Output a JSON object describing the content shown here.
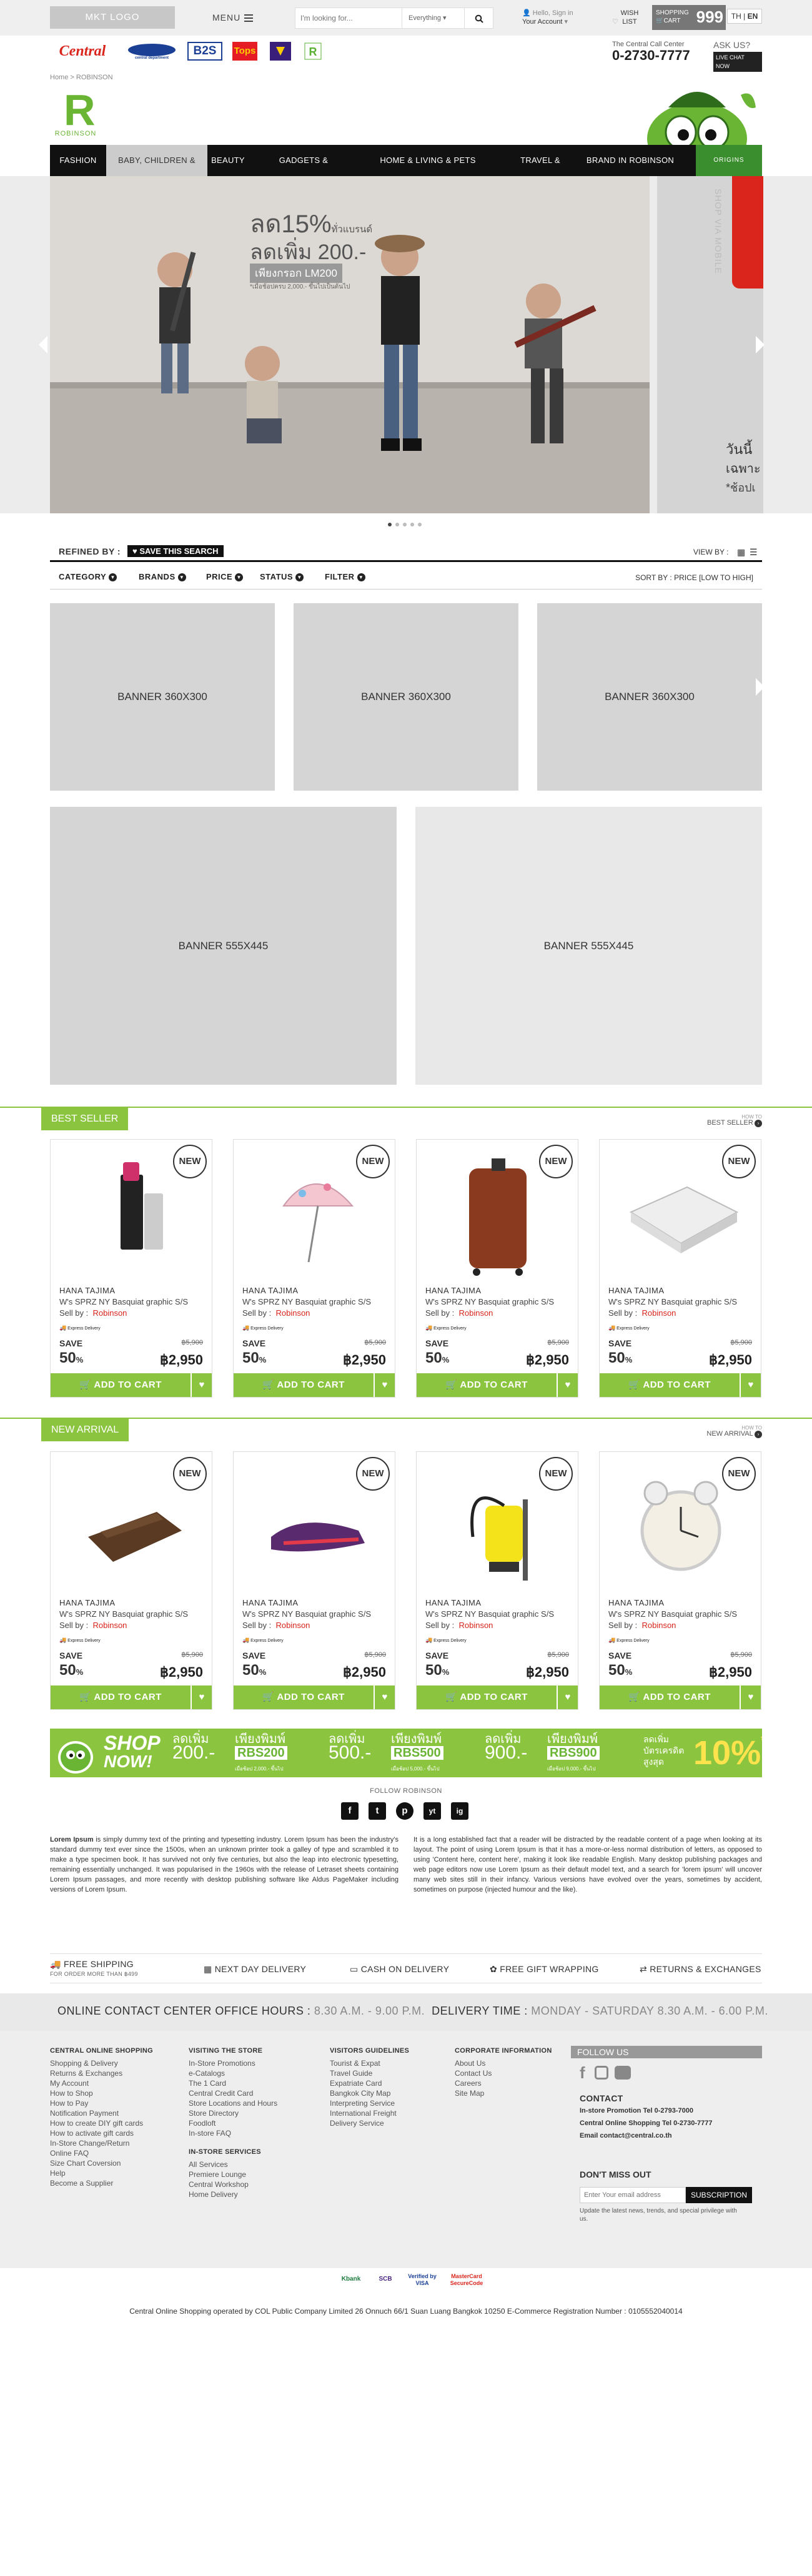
{
  "topbar": {
    "logo": "MKT LOGO",
    "menu": "MENU",
    "search_placeholder": "I'm looking for...",
    "search_category": "Everything",
    "account_greeting": "Hello, Sign in",
    "account_label": "Your Account",
    "wish_label": "WISH LIST",
    "cart_label_1": "SHOPPING",
    "cart_label_2": "CART",
    "cart_count": "999",
    "lang_th": "TH",
    "lang_en": "EN"
  },
  "brands": [
    "Central",
    "Central Department",
    "B2S",
    "Tops",
    "Supersports",
    "Robinson"
  ],
  "contact": {
    "label": "The Central Call Center",
    "number": "0-2730-7777",
    "ask": "ASK US?",
    "chat": "LIVE CHAT NOW"
  },
  "breadcrumb": "Home > ROBINSON",
  "logo_text": "ROBINSON",
  "nav": [
    "FASHION",
    "BABY, CHILDREN & TOYS",
    "BEAUTY",
    "GADGETS & ELECTRONICS",
    "HOME & LIVING & PETS SUPPLIES",
    "TRAVEL & LIFESTYLE",
    "BRAND IN ROBINSON"
  ],
  "nav_logo": "ORIGINS",
  "hero": {
    "line1": "ลด15%",
    "line1b": "ทั่วแบรนด์",
    "line2": "ลดเพิ่ม 200.-",
    "line3": "เพียงกรอก LM200",
    "line4": "*เมื่อช้อปครบ 2,000.- ขึ้นไปเป็นต้นไป",
    "side_text": "SHOP VIA MOBILE",
    "side_thai": "วันนี้",
    "side_thai2": "เฉพาะ",
    "side_thai3": "*ช้อปเ",
    "slides": 5,
    "active": 1
  },
  "refine": {
    "label": "REFINED BY :",
    "save": "SAVE THIS SEARCH",
    "view_by": "VIEW BY :"
  },
  "filters": [
    "CATEGORY",
    "BRANDS",
    "PRICE",
    "STATUS",
    "FILTER"
  ],
  "sort": "SORT BY : PRICE [LOW TO HIGH]",
  "banners_small": [
    "BANNER 360X300",
    "BANNER 360X300",
    "BANNER 360X300"
  ],
  "banners_large": [
    "BANNER 555X445",
    "BANNER 555X445"
  ],
  "sections": [
    {
      "title": "BEST SELLER",
      "howto": "HOW TO",
      "link": "BEST SELLER"
    },
    {
      "title": "NEW ARRIVAL",
      "howto": "HOW TO",
      "link": "NEW ARRIVAL"
    }
  ],
  "product": {
    "badge": "NEW",
    "brand": "HANA TAJIMA",
    "name": "W's SPRZ NY Basquiat graphic S/S",
    "sell_by": "Sell by :",
    "seller": "Robinson",
    "express": "Express Delivery",
    "save": "SAVE",
    "old_price": "฿5,900",
    "percent": "50",
    "percent_sign": "%",
    "price": "฿2,950",
    "add_to_cart": "ADD TO CART"
  },
  "promo": {
    "shop": "SHOP",
    "now": "NOW!",
    "items": [
      {
        "a": "ลดเพิ่ม",
        "b": "200.-",
        "c": "เพียงพิมพ์",
        "d": "RBS200",
        "e": "เมื่อช้อป 2,000.- ขึ้นไป"
      },
      {
        "a": "ลดเพิ่ม",
        "b": "500.-",
        "c": "เพียงพิมพ์",
        "d": "RBS500",
        "e": "เมื่อช้อป 5,000.- ขึ้นไป"
      },
      {
        "a": "ลดเพิ่ม",
        "b": "900.-",
        "c": "เพียงพิมพ์",
        "d": "RBS900",
        "e": "เมื่อช้อป 9,000.- ขึ้นไป"
      }
    ],
    "card_a": "ลดเพิ่ม",
    "card_b": "บัตรเครดิต",
    "card_c": "สูงสุด",
    "card_pct": "10%",
    "card_star": "*"
  },
  "follow": "FOLLOW ROBINSON",
  "social": [
    "f",
    "t",
    "p",
    "yt",
    "ig"
  ],
  "lorem_left_bold": "Lorem Ipsum",
  "lorem_left": " is simply dummy text of the printing and typesetting industry. Lorem Ipsum has been the industry's standard dummy text ever since the 1500s, when an unknown printer took a galley of type and scrambled it to make a type specimen book. It has survived not only five centuries, but also the leap into electronic typesetting, remaining essentially unchanged. It was popularised in the 1960s with the release of Letraset sheets containing Lorem Ipsum passages, and more recently with desktop publishing software like Aldus PageMaker including versions of Lorem Ipsum.",
  "lorem_right": "It is a long established fact that a reader will be distracted by the readable content of a page when looking at its layout. The point of using Lorem Ipsum is that it has a more-or-less normal distribution of letters, as opposed to using 'Content here, content here', making it look like readable English. Many desktop publishing packages and web page editors now use Lorem Ipsum as their default model text, and a search for 'lorem ipsum' will uncover many web sites still in their infancy. Various versions have evolved over the years, sometimes by accident, sometimes on purpose (injected humour and the like).",
  "services": [
    {
      "label": "FREE SHIPPING",
      "sub": "FOR ORDER MORE THAN ฿499"
    },
    {
      "label": "NEXT DAY DELIVERY",
      "sub": ""
    },
    {
      "label": "CASH ON DELIVERY",
      "sub": ""
    },
    {
      "label": "FREE GIFT WRAPPING",
      "sub": ""
    },
    {
      "label": "RETURNS & EXCHANGES",
      "sub": ""
    }
  ],
  "office": {
    "label": "ONLINE CONTACT CENTER OFFICE HOURS :",
    "hours": "8.30 A.M. - 9.00 P.M.",
    "delivery_label": "DELIVERY TIME :",
    "delivery": "MONDAY - SATURDAY 8.30 A.M. - 6.00 P.M."
  },
  "footer": {
    "col1_title": "CENTRAL ONLINE SHOPPING",
    "col1": [
      "Shopping & Delivery",
      "Returns & Exchanges",
      "My Account",
      "How to Shop",
      "How to Pay",
      "Notification Payment",
      "How to create DIY gift cards",
      "How to activate gift cards",
      "In-Store Change/Return",
      "Online FAQ",
      "Size Chart Coversion",
      "Help",
      "Become a Supplier"
    ],
    "col2_title": "VISITING THE STORE",
    "col2": [
      "In-Store Promotions",
      "e-Catalogs",
      "The 1 Card",
      "Central Credit Card",
      "Store Locations and Hours",
      "Store Directory",
      "Foodloft",
      "In-store FAQ"
    ],
    "col2b_title": "IN-STORE SERVICES",
    "col2b": [
      "All Services",
      "Premiere Lounge",
      "Central Workshop",
      "Home Delivery"
    ],
    "col3_title": "VISITORS GUIDELINES",
    "col3": [
      "Tourist & Expat",
      "Travel Guide",
      "Expatriate Card",
      "Bangkok City Map",
      "Interpreting Service",
      "International Freight",
      "Delivery Service"
    ],
    "col4_title": "CORPORATE INFORMATION",
    "col4": [
      "About Us",
      "Contact Us",
      "Careers",
      "Site Map"
    ],
    "follow_us": "FOLLOW US",
    "contact_title": "CONTACT",
    "contact": [
      "In-store Promotion Tel 0-2793-7000",
      "Central Online Shopping Tel 0-2730-7777",
      "Email contact@central.co.th"
    ],
    "missout_title": "DON'T MISS OUT",
    "email_placeholder": "Enter Your email address",
    "subscribe": "SUBSCRIPTION",
    "missout_note": "Update the latest news, trends, and special privilege with us."
  },
  "payments": [
    "Kbank",
    "SCB",
    "Verified by VISA",
    "MasterCard SecureCode"
  ],
  "bottom": "Central Online Shopping operated by COL Public Company Limited 26 Onnuch 66/1 Suan Luang Bangkok 10250 E-Commerce Registration Number : 0105552040014"
}
